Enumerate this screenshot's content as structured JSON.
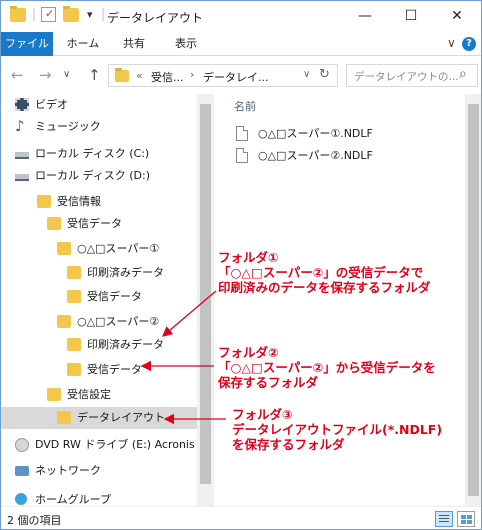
{
  "window": {
    "title": "データレイアウト",
    "controls": {
      "minimize": "—",
      "maximize": "☐",
      "close": "✕"
    },
    "qa_separator": "|",
    "qa_dropdown": "▾"
  },
  "ribbon": {
    "tabs": [
      "ファイル",
      "ホーム",
      "共有",
      "表示"
    ],
    "expand_icon": "∨",
    "help_icon": "?"
  },
  "address": {
    "back": "←",
    "forward": "→",
    "history": "∨",
    "up": "↑",
    "overflow": "«",
    "crumbs": [
      "受信...",
      "データレイ..."
    ],
    "sep": "›",
    "dropdown": "∨",
    "refresh": "↻",
    "search_placeholder": "データレイアウトの...",
    "search_icon": "⌕"
  },
  "nav": {
    "items": [
      {
        "label": "ビデオ",
        "icon": "video-icon",
        "level": 1
      },
      {
        "label": "ミュージック",
        "icon": "music-icon",
        "level": 1
      },
      {
        "label": "ローカル ディスク (C:)",
        "icon": "drive-icon",
        "level": 1
      },
      {
        "label": "ローカル ディスク (D:)",
        "icon": "drive-icon",
        "level": 1
      },
      {
        "label": "受信情報",
        "icon": "folder-icon",
        "level": 2
      },
      {
        "label": "受信データ",
        "icon": "folder-icon",
        "level": 3
      },
      {
        "label": "○△□スーパー①",
        "icon": "folder-icon",
        "level": 4
      },
      {
        "label": "印刷済みデータ",
        "icon": "folder-icon",
        "level": 5
      },
      {
        "label": "受信データ",
        "icon": "folder-icon",
        "level": 5
      },
      {
        "label": "○△□スーパー②",
        "icon": "folder-icon",
        "level": 4
      },
      {
        "label": "印刷済みデータ",
        "icon": "folder-icon",
        "level": 5
      },
      {
        "label": "受信データ",
        "icon": "folder-icon",
        "level": 5
      },
      {
        "label": "受信設定",
        "icon": "folder-icon",
        "level": 3
      },
      {
        "label": "データレイアウト",
        "icon": "folder-icon",
        "level": 4,
        "selected": true
      },
      {
        "label": "DVD RW ドライブ (E:) Acronis",
        "icon": "dvd-icon",
        "level": 1
      },
      {
        "label": "ネットワーク",
        "icon": "network-icon",
        "level": 1
      },
      {
        "label": "ホームグループ",
        "icon": "homegroup-icon",
        "level": 1
      }
    ]
  },
  "content": {
    "column_name": "名前",
    "files": [
      "○△□スーパー①.NDLF",
      "○△□スーパー②.NDLF"
    ]
  },
  "status": {
    "item_count": "2 個の項目"
  },
  "annotations": [
    {
      "lines": [
        "フォルダ①",
        "「○△□スーパー②」の受信データで",
        "印刷済みのデータを保存するフォルダ"
      ]
    },
    {
      "lines": [
        "フォルダ②",
        "「○△□スーパー②」から受信データを",
        "保存するフォルダ"
      ]
    },
    {
      "lines": [
        "フォルダ③",
        "データレイアウトファイル(*.NDLF)",
        "を保存するフォルダ"
      ]
    }
  ],
  "colors": {
    "accent": "#1979ca",
    "annotation": "#e0001a",
    "folder": "#f3c84a",
    "selection": "#d9d9d9"
  }
}
